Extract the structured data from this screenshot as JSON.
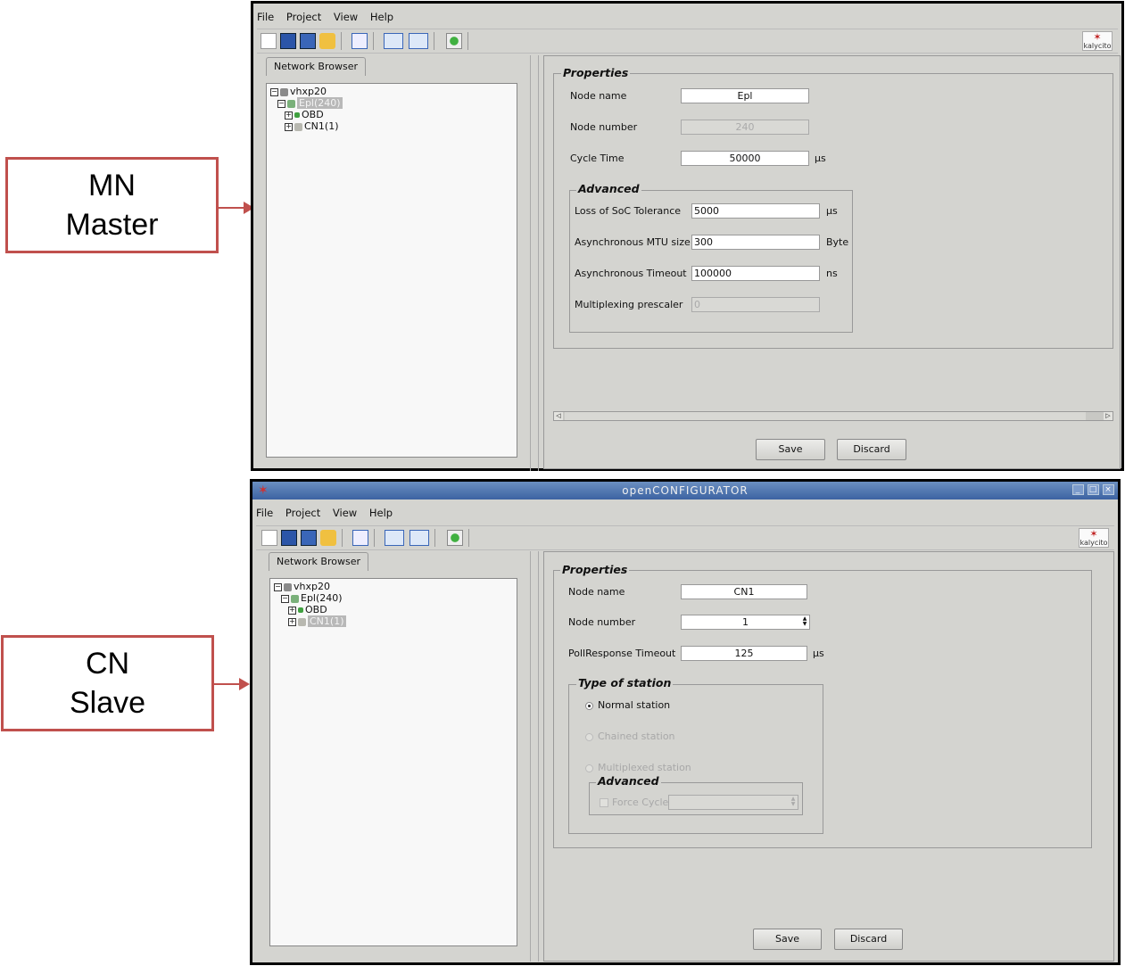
{
  "callouts": {
    "mn": {
      "line1": "MN",
      "line2": "Master"
    },
    "cn": {
      "line1": "CN",
      "line2": "Slave"
    }
  },
  "colors": {
    "callout_border": "#c0504d",
    "titlebar": "#3c63a2",
    "window_bg": "#d4d4d0"
  },
  "top": {
    "menu": [
      "File",
      "Project",
      "View",
      "Help"
    ],
    "logo_text": "kalycito",
    "tab": "Network Browser",
    "tree": {
      "root": "vhxp20",
      "mn": "Epl(240)",
      "obd": "OBD",
      "cn": "CN1(1)"
    },
    "properties": {
      "legend": "Properties",
      "node_name_label": "Node name",
      "node_name": "Epl",
      "node_number_label": "Node number",
      "node_number": "240",
      "cycle_time_label": "Cycle Time",
      "cycle_time": "50000",
      "cycle_time_unit": "µs",
      "advanced": {
        "legend": "Advanced",
        "loss_label": "Loss of SoC Tolerance",
        "loss": "5000",
        "loss_unit": "µs",
        "mtu_label": "Asynchronous MTU size",
        "mtu": "300",
        "mtu_unit": "Byte",
        "timeout_label": "Asynchronous Timeout",
        "timeout": "100000",
        "timeout_unit": "ns",
        "mux_label": "Multiplexing prescaler",
        "mux": "0"
      }
    },
    "save": "Save",
    "discard": "Discard"
  },
  "bottom": {
    "title": "openCONFIGURATOR",
    "menu": [
      "File",
      "Project",
      "View",
      "Help"
    ],
    "logo_text": "kalycito",
    "tab": "Network Browser",
    "tree": {
      "root": "vhxp20",
      "mn": "Epl(240)",
      "obd": "OBD",
      "cn": "CN1(1)"
    },
    "properties": {
      "legend": "Properties",
      "node_name_label": "Node name",
      "node_name": "CN1",
      "node_number_label": "Node number",
      "node_number": "1",
      "poll_label": "PollResponse Timeout",
      "poll": "125",
      "poll_unit": "µs",
      "station": {
        "legend": "Type of station",
        "normal": "Normal station",
        "chained": "Chained station",
        "multiplexed": "Multiplexed station",
        "advanced_legend": "Advanced",
        "force_cycle": "Force Cycle"
      }
    },
    "save": "Save",
    "discard": "Discard"
  }
}
